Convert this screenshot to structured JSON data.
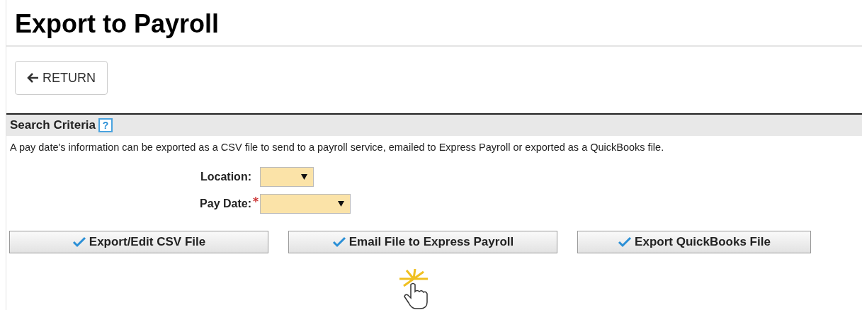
{
  "title": "Export to Payroll",
  "return_button": {
    "label": "RETURN"
  },
  "section": {
    "title": "Search Criteria",
    "help": "?",
    "description": "A pay date's information can be exported as a CSV file to send to a payroll service, emailed to Express Payroll or exported as a QuickBooks file."
  },
  "fields": [
    {
      "label": "Location:",
      "required": false
    },
    {
      "label": "Pay Date:",
      "required": true
    }
  ],
  "actions": [
    {
      "label": "Export/Edit CSV File"
    },
    {
      "label": "Email File to Express Payroll"
    },
    {
      "label": "Export QuickBooks File"
    }
  ]
}
